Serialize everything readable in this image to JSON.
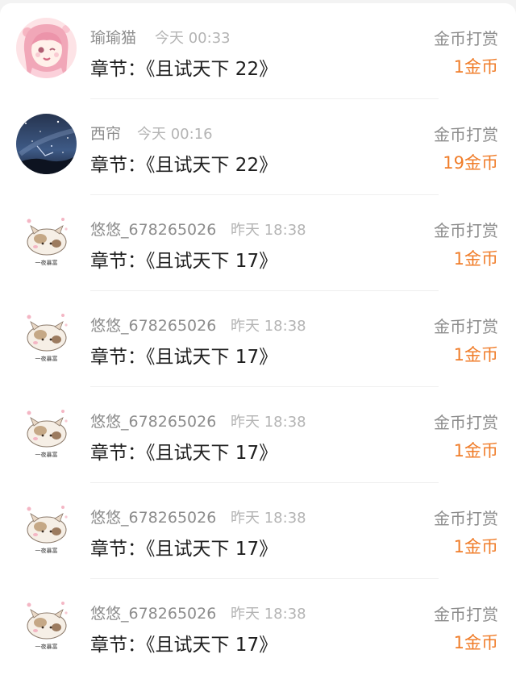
{
  "rewards": [
    {
      "user": "瑜瑜猫",
      "time": "今天 00:33",
      "chapter_prefix": "章节：",
      "chapter": "《且试天下 22》",
      "type": "金币打赏",
      "amount": "1金币",
      "avatar": "anime-girl-avatar"
    },
    {
      "user": "西帘",
      "time": "今天 00:16",
      "chapter_prefix": "章节：",
      "chapter": "《且试天下 22》",
      "type": "金币打赏",
      "amount": "19金币",
      "avatar": "night-sky-avatar"
    },
    {
      "user": "悠悠_678265026",
      "time": "昨天 18:38",
      "chapter_prefix": "章节：",
      "chapter": "《且试天下 17》",
      "type": "金币打赏",
      "amount": "1金币",
      "avatar": "cat-avatar",
      "avatar_text": "一夜暴富"
    },
    {
      "user": "悠悠_678265026",
      "time": "昨天 18:38",
      "chapter_prefix": "章节：",
      "chapter": "《且试天下 17》",
      "type": "金币打赏",
      "amount": "1金币",
      "avatar": "cat-avatar",
      "avatar_text": "一夜暴富"
    },
    {
      "user": "悠悠_678265026",
      "time": "昨天 18:38",
      "chapter_prefix": "章节：",
      "chapter": "《且试天下 17》",
      "type": "金币打赏",
      "amount": "1金币",
      "avatar": "cat-avatar",
      "avatar_text": "一夜暴富"
    },
    {
      "user": "悠悠_678265026",
      "time": "昨天 18:38",
      "chapter_prefix": "章节：",
      "chapter": "《且试天下 17》",
      "type": "金币打赏",
      "amount": "1金币",
      "avatar": "cat-avatar",
      "avatar_text": "一夜暴富"
    },
    {
      "user": "悠悠_678265026",
      "time": "昨天 18:38",
      "chapter_prefix": "章节：",
      "chapter": "《且试天下 17》",
      "type": "金币打赏",
      "amount": "1金币",
      "avatar": "cat-avatar",
      "avatar_text": "一夜暴富"
    }
  ],
  "colors": {
    "amount": "#f07d2a",
    "name": "#8c8c8c",
    "time": "#b4b4b4",
    "chapter": "#1f1f1f"
  }
}
